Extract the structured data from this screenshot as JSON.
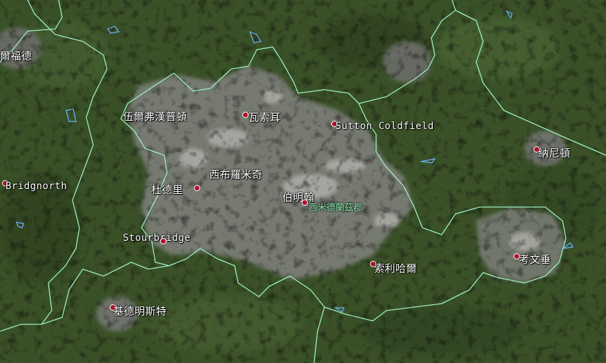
{
  "map": {
    "colors": {
      "countryside": "#3a5128",
      "urban": "#7b7e78",
      "urban_bright": "#b7b8b2",
      "boundary": "#9ef0c4",
      "water": "#6cb6ff",
      "marker": "#b0122a"
    },
    "region_label": "西米德蘭茲郡",
    "places": [
      {
        "id": "telford",
        "name": "爾福德"
      },
      {
        "id": "wolverhampton",
        "name": "伍爾弗漢普頓"
      },
      {
        "id": "walsall",
        "name": "瓦索耳"
      },
      {
        "id": "sutton-coldfield",
        "name": "Sutton Coldfield"
      },
      {
        "id": "nuneaton",
        "name": "納尼頓"
      },
      {
        "id": "bridgnorth",
        "name": "Bridgnorth"
      },
      {
        "id": "west-bromwich",
        "name": "西布羅米奇"
      },
      {
        "id": "dudley",
        "name": "杜德里"
      },
      {
        "id": "birmingham",
        "name": "伯明翰"
      },
      {
        "id": "stourbridge",
        "name": "Stourbridge"
      },
      {
        "id": "solihull",
        "name": "索利哈爾"
      },
      {
        "id": "coventry",
        "name": "考文垂"
      },
      {
        "id": "kidderminster",
        "name": "基德明斯特"
      }
    ]
  }
}
